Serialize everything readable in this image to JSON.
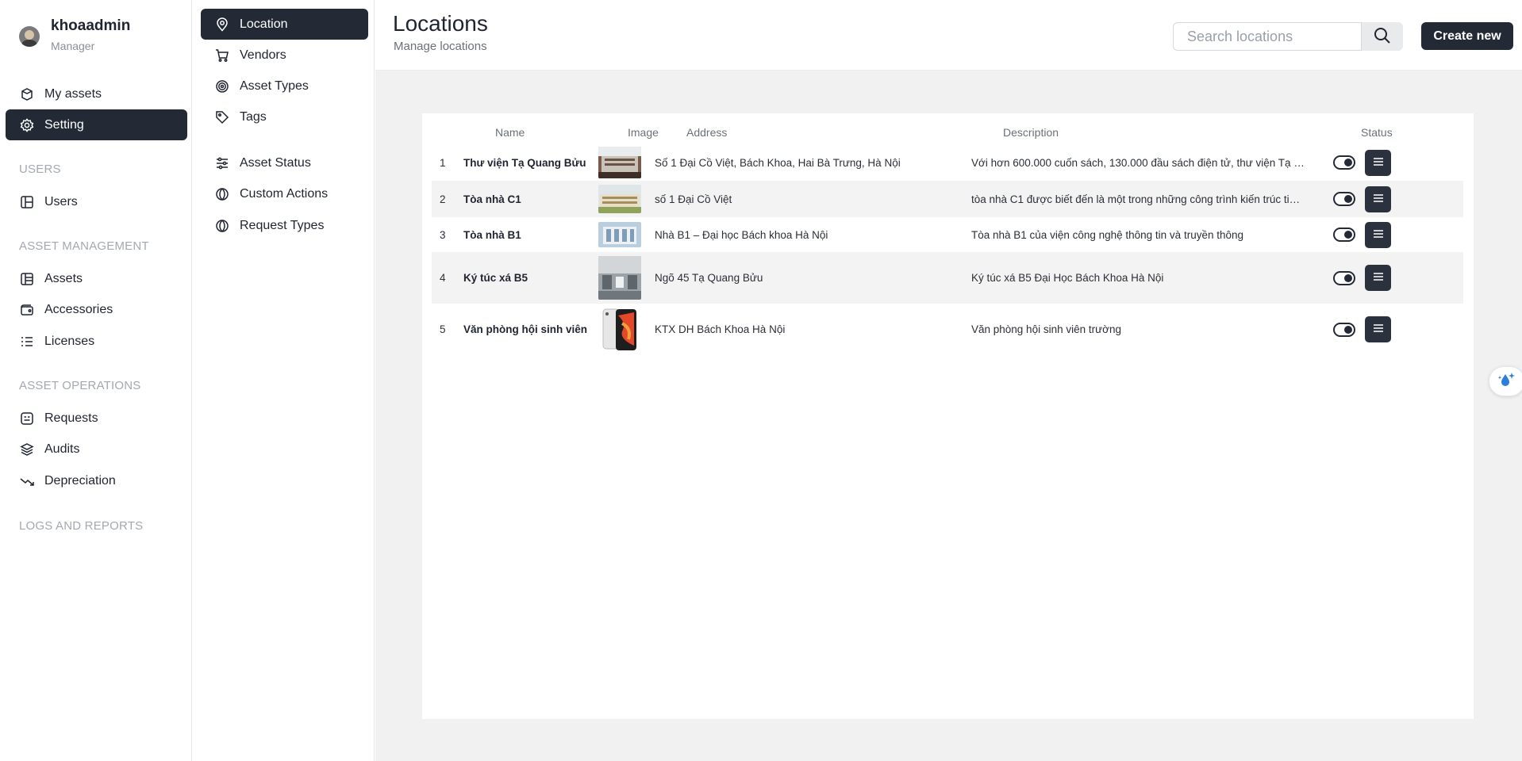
{
  "user": {
    "name": "khoaadmin",
    "role": "Manager"
  },
  "sidebar": {
    "items": [
      {
        "label": "My assets"
      },
      {
        "label": "Setting"
      },
      {
        "label": "Users"
      },
      {
        "label": "Assets"
      },
      {
        "label": "Accessories"
      },
      {
        "label": "Licenses"
      },
      {
        "label": "Requests"
      },
      {
        "label": "Audits"
      },
      {
        "label": "Depreciation"
      }
    ],
    "sections": [
      "USERS",
      "ASSET MANAGEMENT",
      "ASSET OPERATIONS",
      "LOGS AND REPORTS"
    ]
  },
  "settings_menu": {
    "items": [
      {
        "label": "Location"
      },
      {
        "label": "Vendors"
      },
      {
        "label": "Asset Types"
      },
      {
        "label": "Tags"
      },
      {
        "label": "Asset Status"
      },
      {
        "label": "Custom Actions"
      },
      {
        "label": "Request Types"
      }
    ]
  },
  "header": {
    "title": "Locations",
    "subtitle": "Manage locations",
    "search_placeholder": "Search locations",
    "create_label": "Create new"
  },
  "table": {
    "columns": [
      "Name",
      "Image",
      "Address",
      "Description",
      "Status"
    ],
    "rows": [
      {
        "index": "1",
        "name": "Thư viện Tạ Quang Bửu",
        "address": "Số 1 Đại Cồ Việt, Bách Khoa, Hai Bà Trưng, Hà Nội",
        "description": "Với hơn 600.000 cuốn sách, 130.000 đầu sách điện tử, thư viện Tạ Quang Bửu",
        "status": true
      },
      {
        "index": "2",
        "name": "Tòa nhà C1",
        "address": "số 1 Đại Cồ Việt",
        "description": "tòa nhà C1 được biết đến là một trong những công trình kiến trúc tiêu biểu",
        "status": true
      },
      {
        "index": "3",
        "name": "Tòa nhà B1",
        "address": "Nhà B1 – Đại học Bách khoa Hà Nội",
        "description": "Tòa nhà B1 của viện công nghệ thông tin và truyền thông",
        "status": true
      },
      {
        "index": "4",
        "name": "Ký túc xá B5",
        "address": "Ngõ 45 Tạ Quang Bửu",
        "description": "Ký túc xá B5 Đại Học Bách Khoa Hà Nội",
        "status": true
      },
      {
        "index": "5",
        "name": "Văn phòng hội sinh viên",
        "address": "KTX DH Bách Khoa Hà Nội",
        "description": "Văn phòng hội sinh viên trường",
        "status": true
      }
    ]
  },
  "colors": {
    "primary": "#232a36",
    "background": "#f1f1f1",
    "muted": "#a4a8af"
  }
}
